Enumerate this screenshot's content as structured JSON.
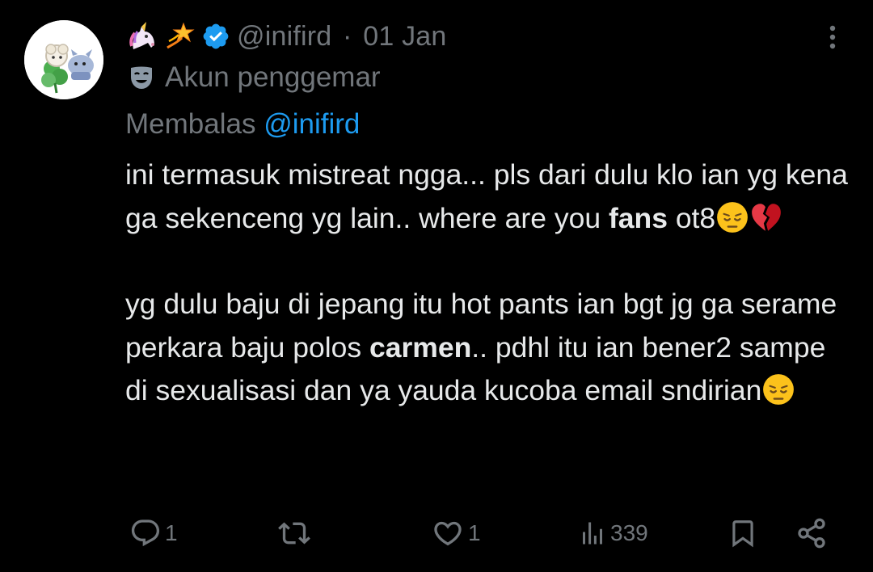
{
  "author": {
    "handle": "@inifird",
    "separator": "·",
    "date": "01 Jan",
    "label": "Akun penggemar",
    "name_emojis": [
      "unicorn-emoji",
      "dizzy-emoji"
    ],
    "verified": true
  },
  "reply": {
    "prefix": "Membalas",
    "mention": "@inifird",
    "mention_color": "#1d9bf0"
  },
  "tweet": {
    "p1_a": "ini termasuk mistreat ngga... pls dari dulu klo ian yg kena ga sekenceng yg lain.. where are you ",
    "p1_bold": "fans",
    "p1_b": " ot8",
    "p1_emojis": [
      "pensive-face-emoji",
      "broken-heart-emoji"
    ],
    "p2_a": "yg dulu baju di jepang itu hot pants ian bgt jg ga serame perkara baju polos ",
    "p2_bold": "carmen",
    "p2_b": ".. pdhl itu ian bener2 sampe di sexualisasi dan ya yauda kucoba email sndirian",
    "p2_emojis": [
      "pensive-face-emoji"
    ]
  },
  "actions": {
    "reply_count": "1",
    "repost_count": "",
    "like_count": "1",
    "view_count": "339"
  },
  "colors": {
    "background": "#000000",
    "text": "#e7e9ea",
    "muted": "#71767b",
    "accent": "#1d9bf0"
  }
}
